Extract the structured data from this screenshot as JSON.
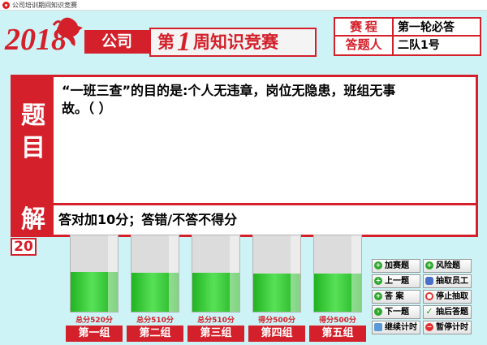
{
  "window": {
    "title": "公司培训期间知识竞赛"
  },
  "header": {
    "year_logo": "2018",
    "company": "公司",
    "week_prefix": "第",
    "week_number": "1",
    "week_suffix": "周知识竞赛"
  },
  "info": {
    "round_label": "赛  程",
    "round_value": "第一轮必答",
    "answerer_label": "答题人",
    "answerer_value": "二队1号"
  },
  "question": {
    "label_line1": "题",
    "label_line2": "目",
    "text": "“一班三查”的目的是:个人无违章，岗位无隐患，班组无事故。（ ）"
  },
  "answer": {
    "label": "解",
    "text": "答对加10分；答错/不答不得分"
  },
  "timer": {
    "value": "20"
  },
  "teams": [
    {
      "name": "第一组",
      "score_text": "总分520分",
      "level": 0.52
    },
    {
      "name": "第二组",
      "score_text": "总分510分",
      "level": 0.51
    },
    {
      "name": "第三组",
      "score_text": "总分510分",
      "level": 0.51
    },
    {
      "name": "第四组",
      "score_text": "得分500分",
      "level": 0.5
    },
    {
      "name": "第五组",
      "score_text": "得分500分",
      "level": 0.5
    }
  ],
  "controls": {
    "add_question": "加赛题",
    "prev_question": "上一题",
    "answer": "答  案",
    "next_question": "下一题",
    "continue_timer": "继续计时",
    "risk_question": "风险题",
    "draw_staff": "抽取员工",
    "stop_draw": "停止抽取",
    "draw_then_answer": "抽后答题",
    "pause_timer": "暂停计时"
  },
  "colors": {
    "accent": "#d4202a",
    "background": "#cdf3f6",
    "meter": "#3fd23f"
  }
}
